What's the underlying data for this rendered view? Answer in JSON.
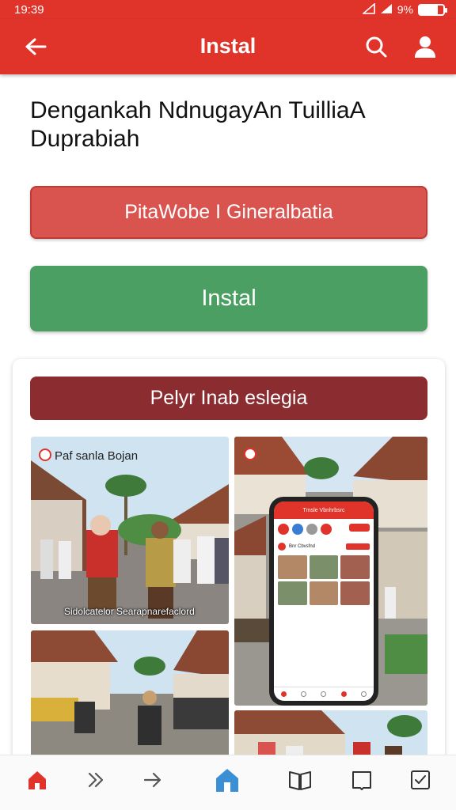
{
  "status_bar": {
    "time": "19:39",
    "battery": "9%"
  },
  "app_bar": {
    "title": "Instal"
  },
  "heading": "Dengankah NdnugayAn TuilliaA Duprabiah",
  "buttons": {
    "secondary_label": "PitaWobe I Gineralbatia",
    "primary_label": "Instal"
  },
  "card": {
    "banner": "Pelyr Inab eslegia",
    "photo1_title": "Paf sanla Bojan",
    "photo1_caption": "Sidolcatelor Searapnarefaclord"
  },
  "phone_mock": {
    "header": "Tmsle Vbnhrbsrc",
    "section": "Bnr Cbvsfnd"
  },
  "colors": {
    "brand_red": "#e0342b",
    "install_green": "#4b9f63",
    "banner_maroon": "#8b2c30",
    "accent_blue": "#3a7bd5"
  },
  "bottom_nav": {
    "items": [
      "home-icon",
      "chevron-double-icon",
      "arrow-right-icon",
      "house-active-icon",
      "book-icon",
      "tablet-icon",
      "checkbox-icon"
    ]
  }
}
